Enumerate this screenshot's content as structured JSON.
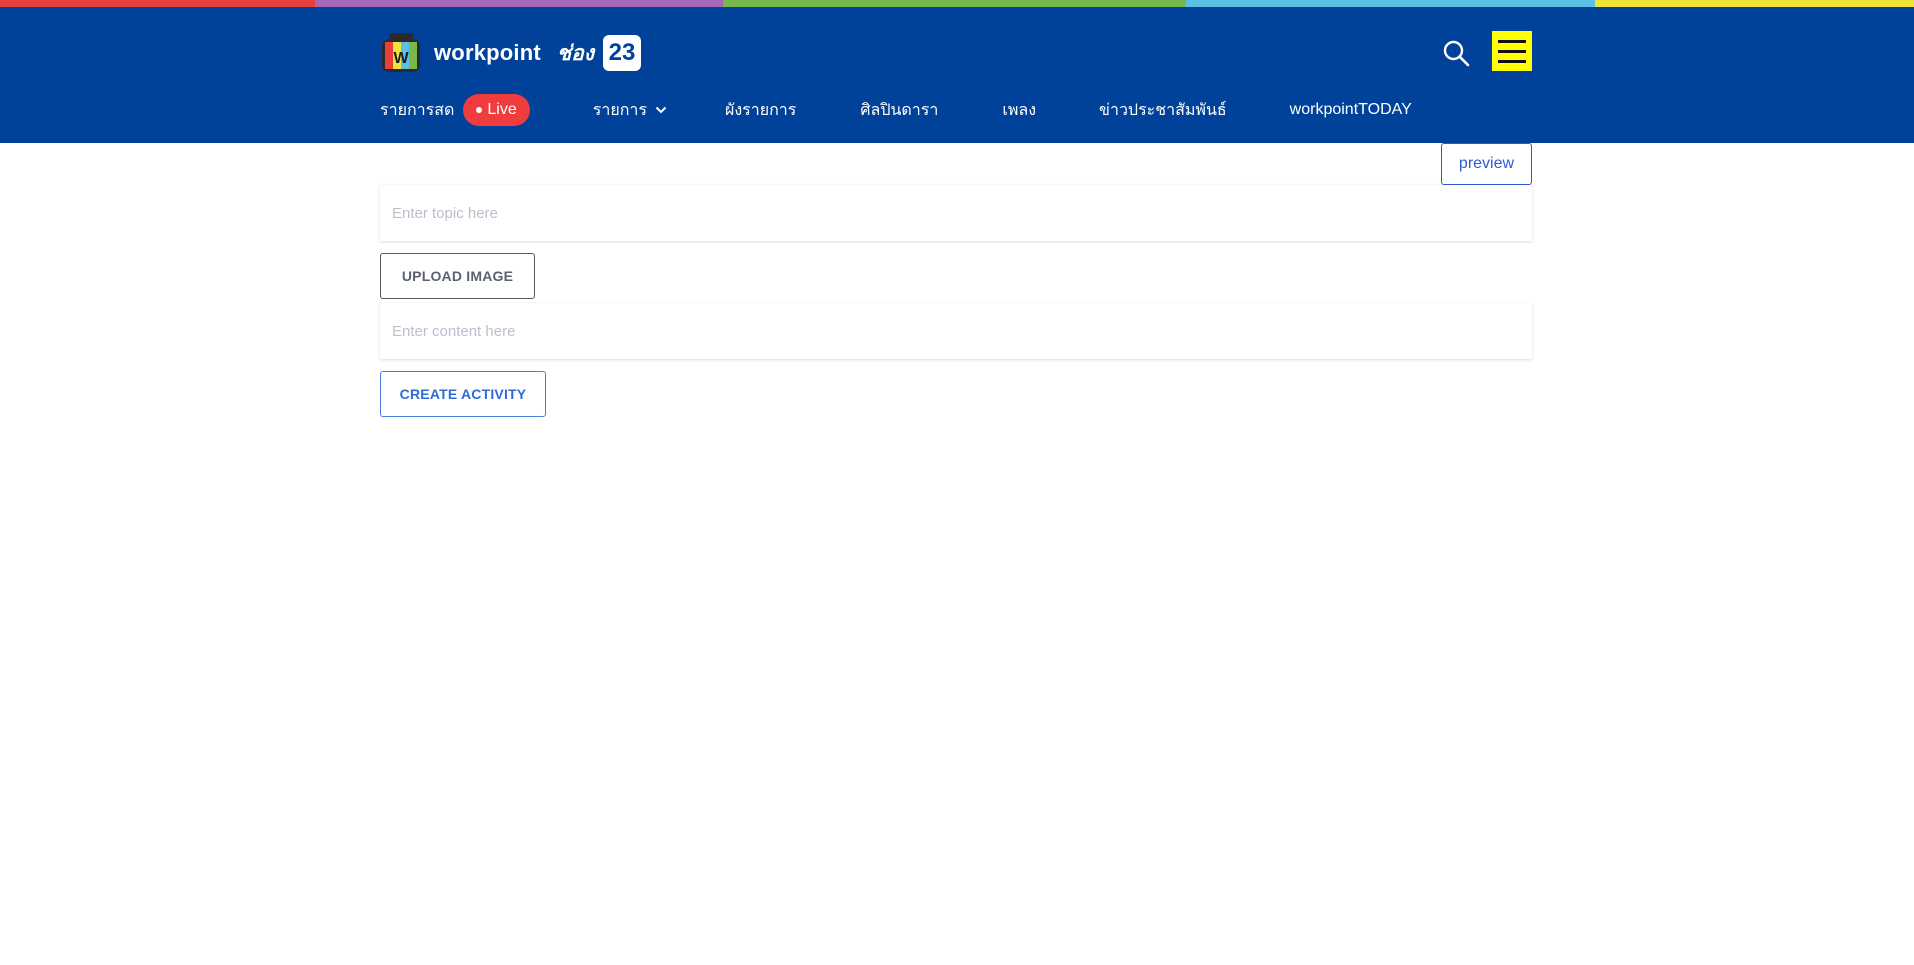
{
  "colors": {
    "header_bg": "#004299",
    "rainbow": [
      "#e8413c",
      "#a667b5",
      "#78b84a",
      "#5bc0e6",
      "#f0e33a"
    ],
    "menu_button": "#ffff00",
    "live_badge": "#f03c3c",
    "accent": "#2f5bd3"
  },
  "header": {
    "logo_icon": "workpoint-tv-logo-icon",
    "logo_text": "workpoint",
    "channel_label": "ช่อง",
    "channel_number": "23",
    "search_icon": "search-icon",
    "menu_icon": "hamburger-menu-icon"
  },
  "nav": {
    "live_label": "รายการสด",
    "live_badge": "Live",
    "programs_label": "รายการ",
    "schedule_label": "ผังรายการ",
    "artists_label": "ศิลปินดารา",
    "music_label": "เพลง",
    "news_label": "ข่าวประชาสัมพันธ์",
    "today_label": "workpointTODAY"
  },
  "form": {
    "preview_label": "preview",
    "topic_placeholder": "Enter topic here",
    "upload_label": "UPLOAD IMAGE",
    "content_placeholder": "Enter content here",
    "create_label": "CREATE ACTIVITY"
  }
}
